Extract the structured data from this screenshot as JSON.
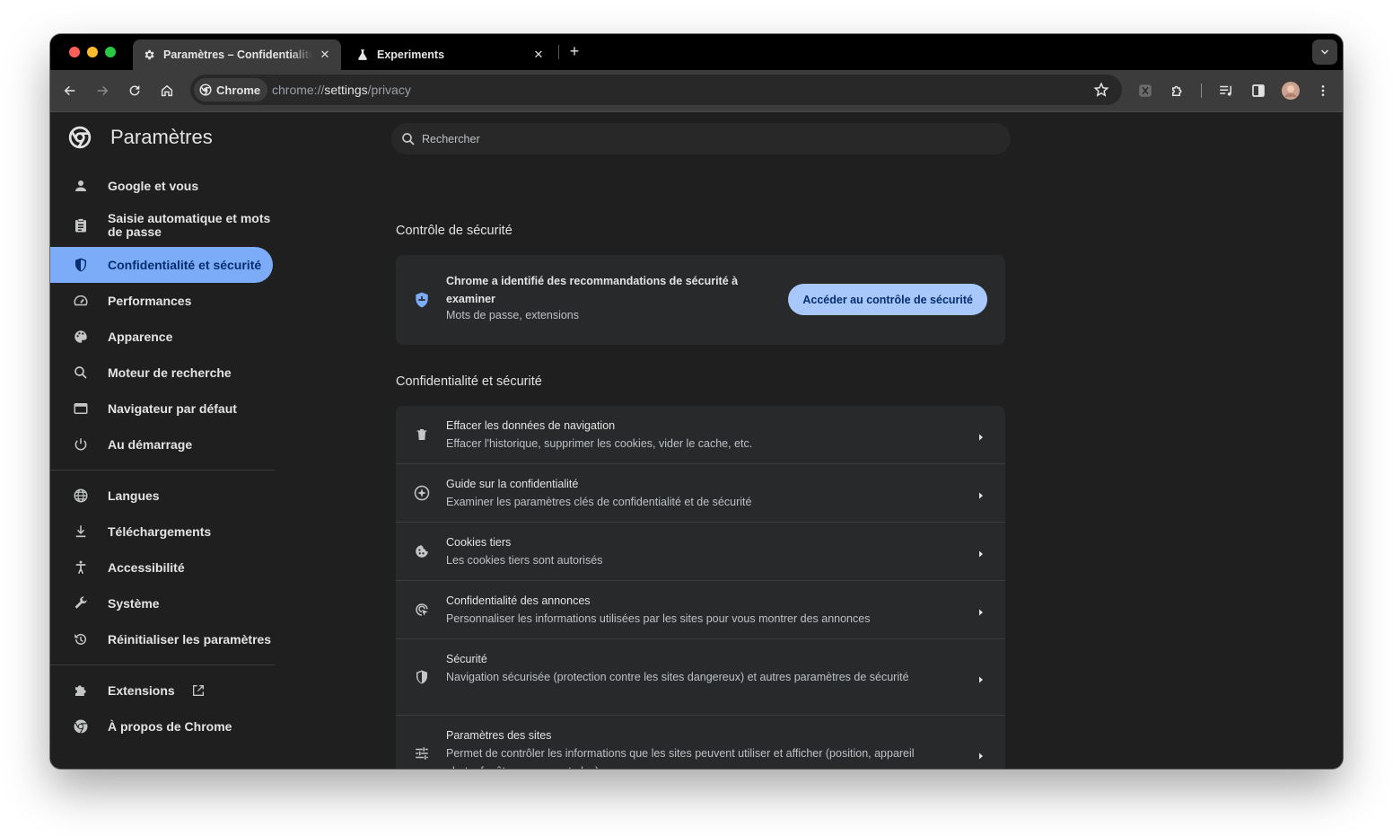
{
  "window": {
    "tabs": [
      {
        "title": "Paramètres – Confidentialité et sécurité",
        "icon": "gear-icon",
        "active": true
      },
      {
        "title": "Experiments",
        "icon": "flask-icon",
        "active": false
      }
    ],
    "new_tab_label": "+"
  },
  "toolbar": {
    "site_chip": "Chrome",
    "url_scheme": "chrome://",
    "url_host": "settings",
    "url_path": "/privacy"
  },
  "sidebar": {
    "title": "Paramètres",
    "items": [
      {
        "label": "Google et vous",
        "icon": "person-icon"
      },
      {
        "label": "Saisie automatique et mots de passe",
        "icon": "clipboard-icon"
      },
      {
        "label": "Confidentialité et sécurité",
        "icon": "shield-icon",
        "active": true
      },
      {
        "label": "Performances",
        "icon": "speedometer-icon"
      },
      {
        "label": "Apparence",
        "icon": "palette-icon"
      },
      {
        "label": "Moteur de recherche",
        "icon": "search-icon"
      },
      {
        "label": "Navigateur par défaut",
        "icon": "browser-icon"
      },
      {
        "label": "Au démarrage",
        "icon": "power-icon"
      }
    ],
    "items2": [
      {
        "label": "Langues",
        "icon": "globe-icon"
      },
      {
        "label": "Téléchargements",
        "icon": "download-icon"
      },
      {
        "label": "Accessibilité",
        "icon": "accessibility-icon"
      },
      {
        "label": "Système",
        "icon": "wrench-icon"
      },
      {
        "label": "Réinitialiser les paramètres",
        "icon": "reset-icon"
      }
    ],
    "items3": [
      {
        "label": "Extensions",
        "icon": "puzzle-icon"
      },
      {
        "label": "À propos de Chrome",
        "icon": "chrome-icon"
      }
    ]
  },
  "search": {
    "placeholder": "Rechercher"
  },
  "safety_check": {
    "section_title": "Contrôle de sécurité",
    "title": "Chrome a identifié des recommandations de sécurité à examiner",
    "subtitle": "Mots de passe, extensions",
    "button": "Accéder au contrôle de sécurité"
  },
  "privacy": {
    "section_title": "Confidentialité et sécurité",
    "rows": [
      {
        "title": "Effacer les données de navigation",
        "subtitle": "Effacer l'historique, supprimer les cookies, vider le cache, etc.",
        "icon": "trash-icon"
      },
      {
        "title": "Guide sur la confidentialité",
        "subtitle": "Examiner les paramètres clés de confidentialité et de sécurité",
        "icon": "compass-icon"
      },
      {
        "title": "Cookies tiers",
        "subtitle": "Les cookies tiers sont autorisés",
        "icon": "cookie-icon"
      },
      {
        "title": "Confidentialité des annonces",
        "subtitle": "Personnaliser les informations utilisées par les sites pour vous montrer des annonces",
        "icon": "ad-privacy-icon"
      },
      {
        "title": "Sécurité",
        "subtitle": "Navigation sécurisée (protection contre les sites dangereux) et autres paramètres de sécurité",
        "icon": "security-shield-icon"
      },
      {
        "title": "Paramètres des sites",
        "subtitle": "Permet de contrôler les informations que les sites peuvent utiliser et afficher (position, appareil photo, fenêtres pop-up et plus)",
        "icon": "sliders-icon"
      }
    ]
  },
  "colors": {
    "accent": "#7cacf8",
    "button": "#a8c7fa",
    "background": "#1f1f1f",
    "card": "#28292a"
  }
}
